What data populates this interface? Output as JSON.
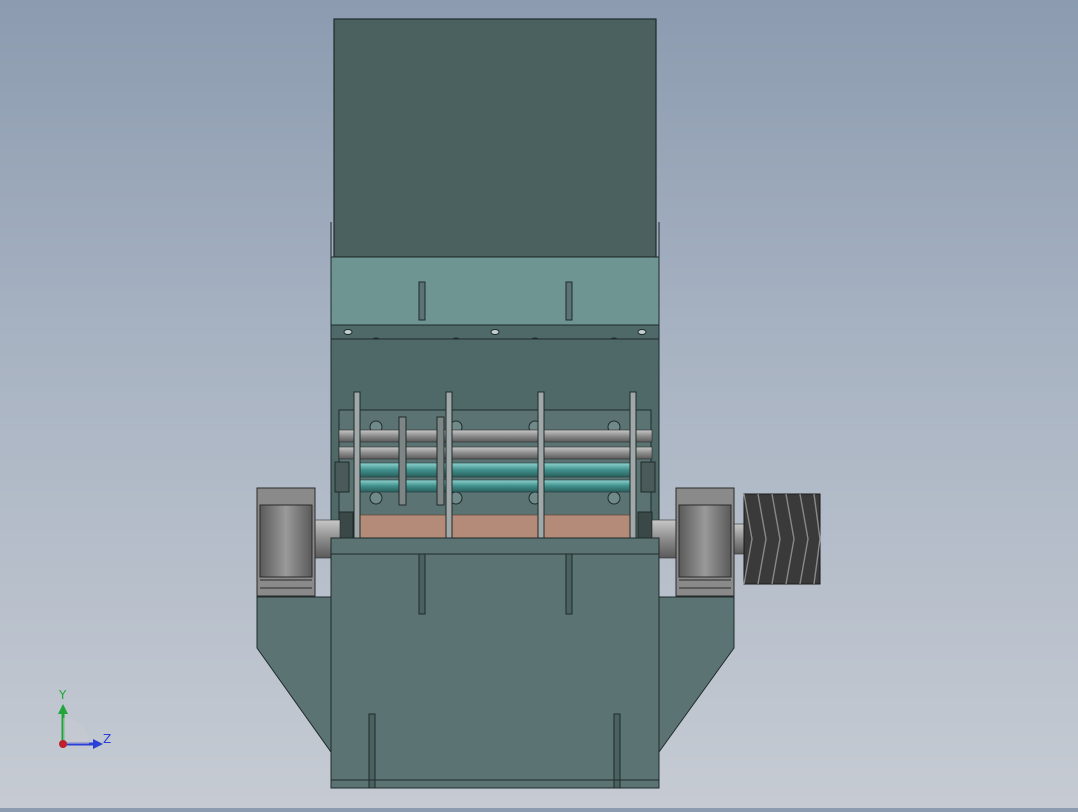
{
  "viewport": {
    "background_top": "#8c9bb0",
    "background_bottom": "#c6cbd3"
  },
  "model": {
    "body_color": "#5b7473",
    "hopper_color": "#4a6160",
    "outline_color": "#1e2a2a",
    "shaft_color": "#8a8a8a",
    "pulley_color": "#3a3a3a",
    "bearing_color": "#6f6f6f",
    "rotor_teal": "#3f8f8c",
    "screen_color": "#b48a78"
  },
  "triad": {
    "y_label": "Y",
    "z_label": "Z",
    "y_color": "#1fa53a",
    "z_color": "#2a3fd6",
    "x_color": "#c0202a"
  }
}
